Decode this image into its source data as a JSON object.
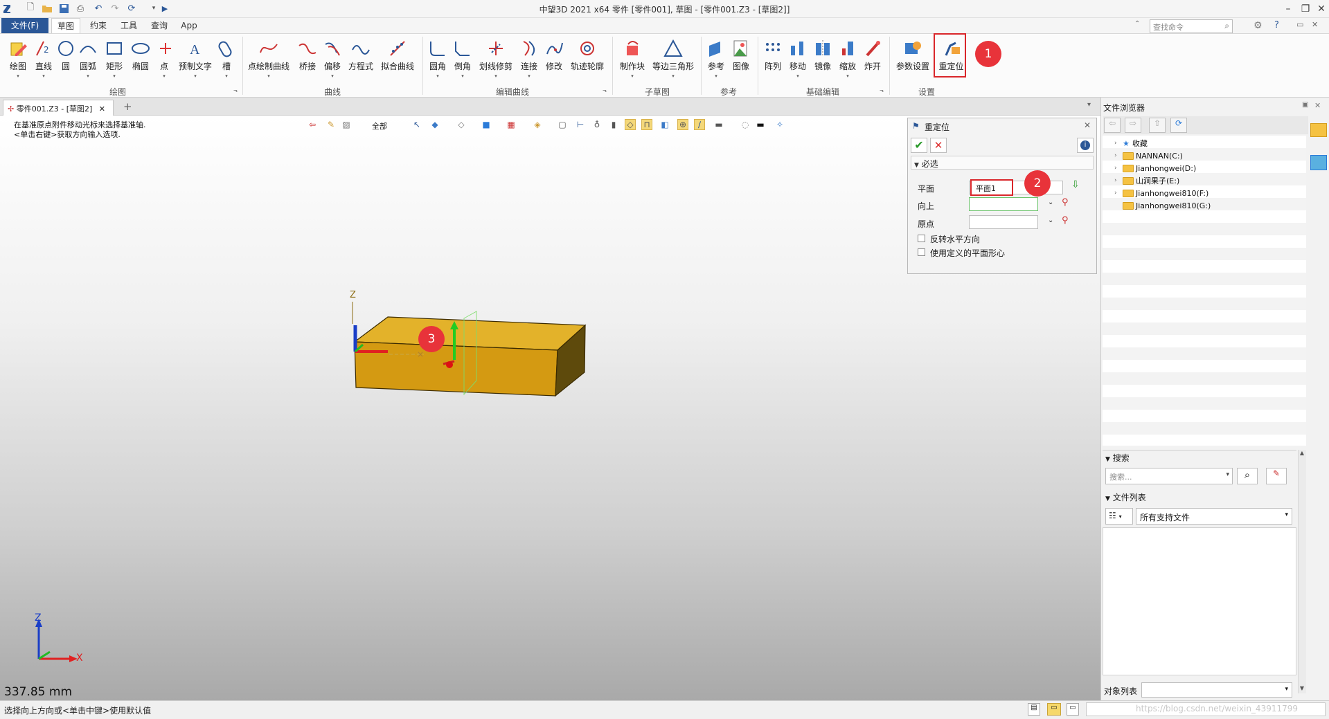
{
  "window": {
    "title": "中望3D 2021 x64      零件 [零件001], 草图 - [零件001.Z3 - [草图2]]"
  },
  "menu": {
    "file": "文件(F)",
    "tabs": [
      "草图",
      "约束",
      "工具",
      "查询",
      "App"
    ]
  },
  "ribbon": {
    "groups": {
      "draw": {
        "label": "绘图",
        "items": [
          "绘图",
          "直线",
          "圆",
          "圆弧",
          "矩形",
          "椭圆",
          "点",
          "预制文字",
          "槽"
        ]
      },
      "curve": {
        "label": "曲线",
        "items": [
          "点绘制曲线",
          "桥接",
          "偏移",
          "方程式",
          "拟合曲线"
        ]
      },
      "edit": {
        "label": "编辑曲线",
        "items": [
          "圆角",
          "倒角",
          "划线修剪",
          "连接",
          "修改",
          "轨迹轮廓"
        ]
      },
      "sub": {
        "label": "子草图",
        "items": [
          "制作块",
          "等边三角形"
        ]
      },
      "ref": {
        "label": "参考",
        "items": [
          "参考",
          "图像"
        ]
      },
      "basic": {
        "label": "基础编辑",
        "items": [
          "阵列",
          "移动",
          "镜像",
          "缩放",
          "炸开"
        ]
      },
      "settings": {
        "label": "设置",
        "items": [
          "参数设置",
          "重定位"
        ]
      }
    }
  },
  "search": {
    "placeholder": "查找命令"
  },
  "document": {
    "tab": "零件001.Z3 - [草图2]"
  },
  "viewport": {
    "hint_line1": "在基准原点附件移动光标来选择基准轴.",
    "hint_line2": "<单击右键>获取方向输入选项.",
    "filter": "全部",
    "measure": "337.85 mm",
    "axis_z": "Z",
    "axis_x": "X"
  },
  "dialog": {
    "title": "重定位",
    "section": "必选",
    "plane_label": "平面",
    "plane_value": "平面1",
    "up_label": "向上",
    "origin_label": "原点",
    "opt1": "反转水平方向",
    "opt2": "使用定义的平面形心"
  },
  "badges": [
    "1",
    "2",
    "3"
  ],
  "browser": {
    "title": "文件浏览器",
    "tree": [
      "收藏",
      "NANNAN(C:)",
      "Jianhongwei(D:)",
      "山涧果子(E:)",
      "Jianhongwei810(F:)",
      "Jianhongwei810(G:)"
    ],
    "search_section": "搜索",
    "search_placeholder": "搜索...",
    "filelist_section": "文件列表",
    "filter_value": "所有支持文件",
    "object_list": "对象列表"
  },
  "status": {
    "text": "选择向上方向或<单击中键>使用默认值",
    "watermark": "https://blog.csdn.net/weixin_43911799"
  },
  "colors": {
    "accent": "#2b5797",
    "highlight": "#d9262a",
    "badge": "#e8333a",
    "block": "#d49a12"
  }
}
